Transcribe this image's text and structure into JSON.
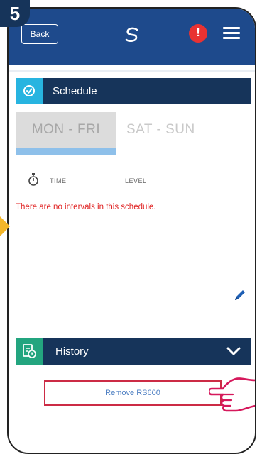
{
  "step": {
    "number": "5"
  },
  "header": {
    "back_label": "Back",
    "alert_symbol": "!"
  },
  "schedule": {
    "title": "Schedule",
    "tabs": [
      "MON - FRI",
      "SAT - SUN"
    ],
    "columns": {
      "time": "TIME",
      "level": "LEVEL"
    },
    "empty_message": "There are no intervals in this schedule."
  },
  "history": {
    "title": "History"
  },
  "actions": {
    "remove_label": "Remove RS600"
  },
  "colors": {
    "header_bar": "#1e4a8c",
    "section_bar": "#16345a",
    "schedule_icon": "#27b4e0",
    "history_icon": "#23a57f",
    "alert": "#e83232",
    "highlight_box": "#cc2b45",
    "hand": "#d6195c",
    "side_arrow": "#f4b62a"
  },
  "icons": [
    "logo-icon",
    "alert-icon",
    "menu-icon",
    "clock-icon",
    "stopwatch-icon",
    "pencil-icon",
    "history-icon",
    "chevron-down-icon",
    "pointing-hand-icon"
  ]
}
